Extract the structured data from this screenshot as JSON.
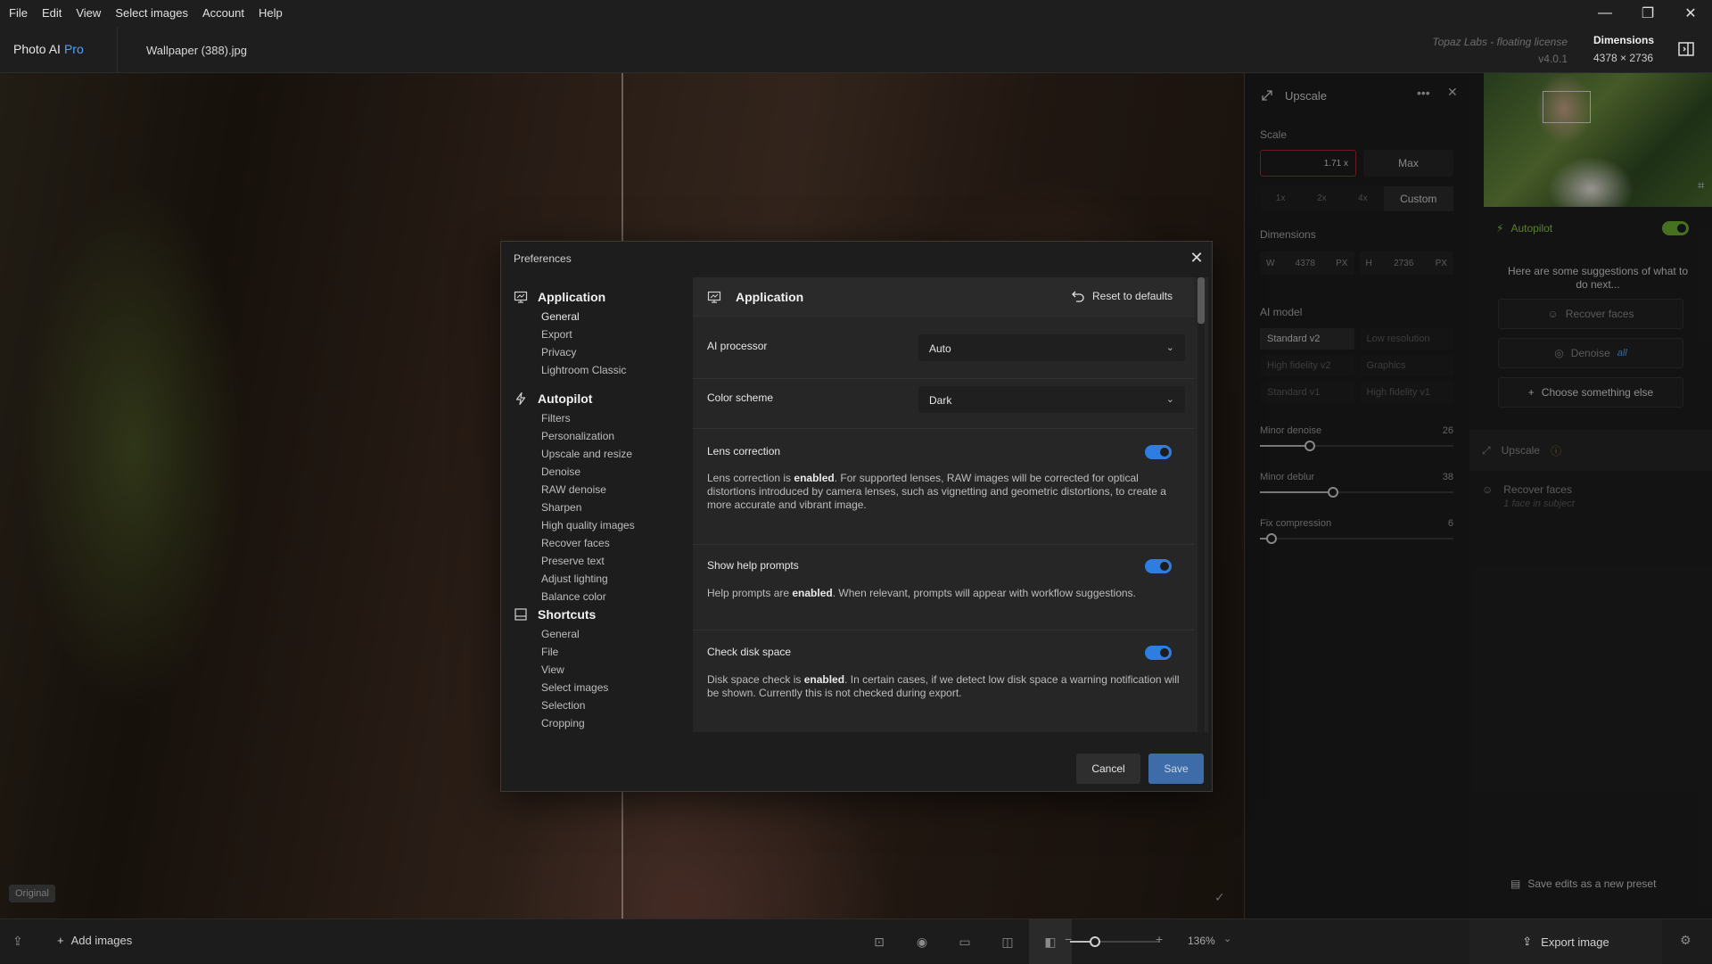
{
  "menu": [
    "File",
    "Edit",
    "View",
    "Select images",
    "Account",
    "Help"
  ],
  "window_controls": {
    "minimize": "—",
    "restore": "❐",
    "close": "✕"
  },
  "app": {
    "name": "Photo AI",
    "edition": "Pro",
    "file": "Wallpaper (388).jpg",
    "license": "Topaz Labs - floating license",
    "version": "v4.0.1"
  },
  "dimensions": {
    "title": "Dimensions",
    "value": "4378 × 2736"
  },
  "canvas": {
    "original_badge": "Original"
  },
  "right_panel": {
    "title": "Upscale",
    "scale_label": "Scale",
    "scale_value": "1.71  x",
    "max_label": "Max",
    "scale_options": [
      "1x",
      "2x",
      "4x",
      "Custom"
    ],
    "selected_scale": "Custom",
    "dimensions_label": "Dimensions",
    "width": {
      "prefix": "W",
      "value": "4378",
      "unit": "PX"
    },
    "height": {
      "prefix": "H",
      "value": "2736",
      "unit": "PX"
    },
    "ai_model_label": "AI model",
    "models": [
      "Standard v2",
      "Low resolution",
      "High fidelity v2",
      "Graphics",
      "Standard v1",
      "High fidelity v1"
    ],
    "selected_model": "Standard v2",
    "sliders": [
      {
        "label": "Minor denoise",
        "value": 26,
        "max": 100
      },
      {
        "label": "Minor deblur",
        "value": 38,
        "max": 100
      },
      {
        "label": "Fix compression",
        "value": 6,
        "max": 100
      }
    ]
  },
  "autopilot_panel": {
    "title": "Autopilot",
    "enabled": true,
    "hint": "Here are some suggestions of what to do next...",
    "suggestions": [
      "Recover faces",
      "Denoise"
    ],
    "denoise_tag": "all",
    "choose_label": "Choose something else",
    "upscale_label": "Upscale",
    "recover_faces_label": "Recover faces",
    "recover_faces_sub": "1 face in subject",
    "save_preset": "Save edits as a new preset"
  },
  "bottom_bar": {
    "add_images": "Add images",
    "zoom": "136%",
    "zoom_level": 0.28,
    "export": "Export image"
  },
  "preferences": {
    "title": "Preferences",
    "nav": [
      {
        "title": "Application",
        "items": [
          "General",
          "Export",
          "Privacy",
          "Lightroom Classic"
        ]
      },
      {
        "title": "Autopilot",
        "items": [
          "Filters",
          "Personalization",
          "Upscale and resize",
          "Denoise",
          "RAW denoise",
          "Sharpen",
          "High quality images",
          "Recover faces",
          "Preserve text",
          "Adjust lighting",
          "Balance color"
        ]
      },
      {
        "title": "Shortcuts",
        "items": [
          "General",
          "File",
          "View",
          "Select images",
          "Selection",
          "Cropping"
        ]
      }
    ],
    "section_title": "Application",
    "reset_label": "Reset to defaults",
    "ai_processor": {
      "label": "AI processor",
      "value": "Auto"
    },
    "color_scheme": {
      "label": "Color scheme",
      "value": "Dark"
    },
    "lens_correction": {
      "label": "Lens correction",
      "enabled": true,
      "desc_pre": "Lens correction is ",
      "desc_state": "enabled",
      "desc_post": ". For supported lenses, RAW images will be corrected for optical distortions introduced by camera lenses, such as vignetting and geometric distortions, to create a more accurate and vibrant image."
    },
    "help_prompts": {
      "label": "Show help prompts",
      "enabled": true,
      "desc_pre": "Help prompts are ",
      "desc_state": "enabled",
      "desc_post": ". When relevant, prompts will appear with workflow suggestions."
    },
    "disk_space": {
      "label": "Check disk space",
      "enabled": true,
      "desc_pre": "Disk space check is ",
      "desc_state": "enabled",
      "desc_post": ". In certain cases, if we detect low disk space a warning notification will be shown. Currently this is not checked during export."
    },
    "cancel_label": "Cancel",
    "save_label": "Save"
  }
}
